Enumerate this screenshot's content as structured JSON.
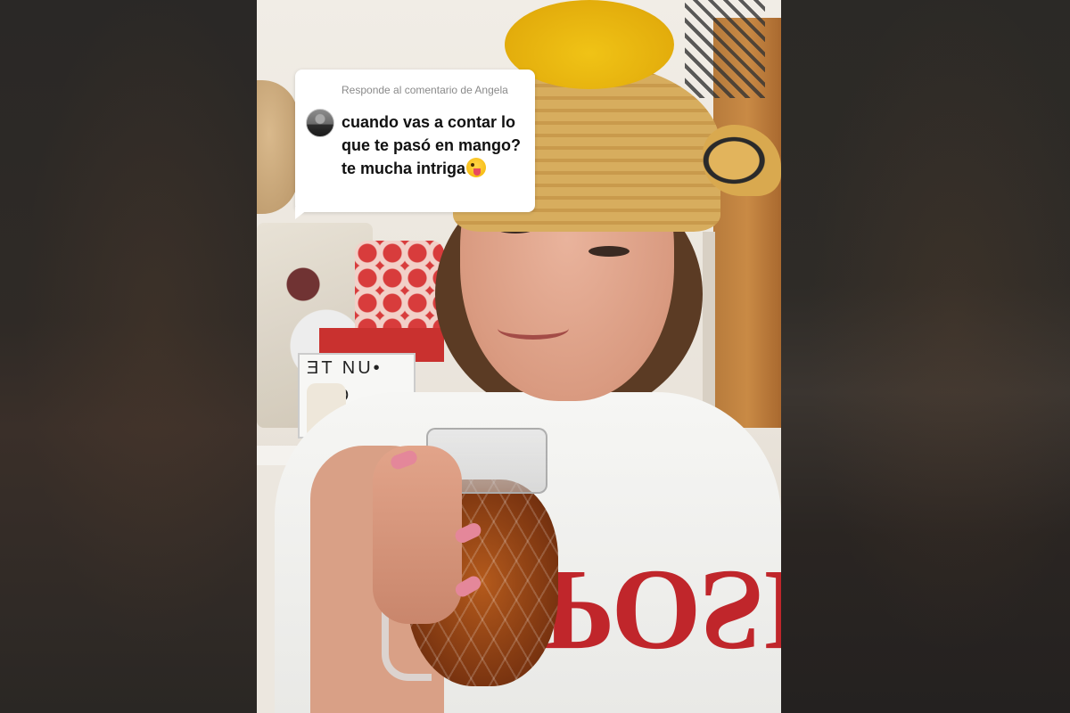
{
  "reply_card": {
    "header": "Responde al comentario de Angela",
    "comment_text": "cuando vas a contar lo que te pasó en mango? te mucha intriga",
    "emoji": "winking-face-with-tongue-icon",
    "avatar": "user-avatar"
  },
  "scene": {
    "lightbox_lines": [
      "ƎT NU•",
      "ᴎOϽ"
    ],
    "shirt_print": "POSITI"
  },
  "colors": {
    "bubble_bg": "#ffffff",
    "header_text": "#8a8a8a",
    "comment_text": "#111111",
    "side_panels": "#2a2826"
  }
}
